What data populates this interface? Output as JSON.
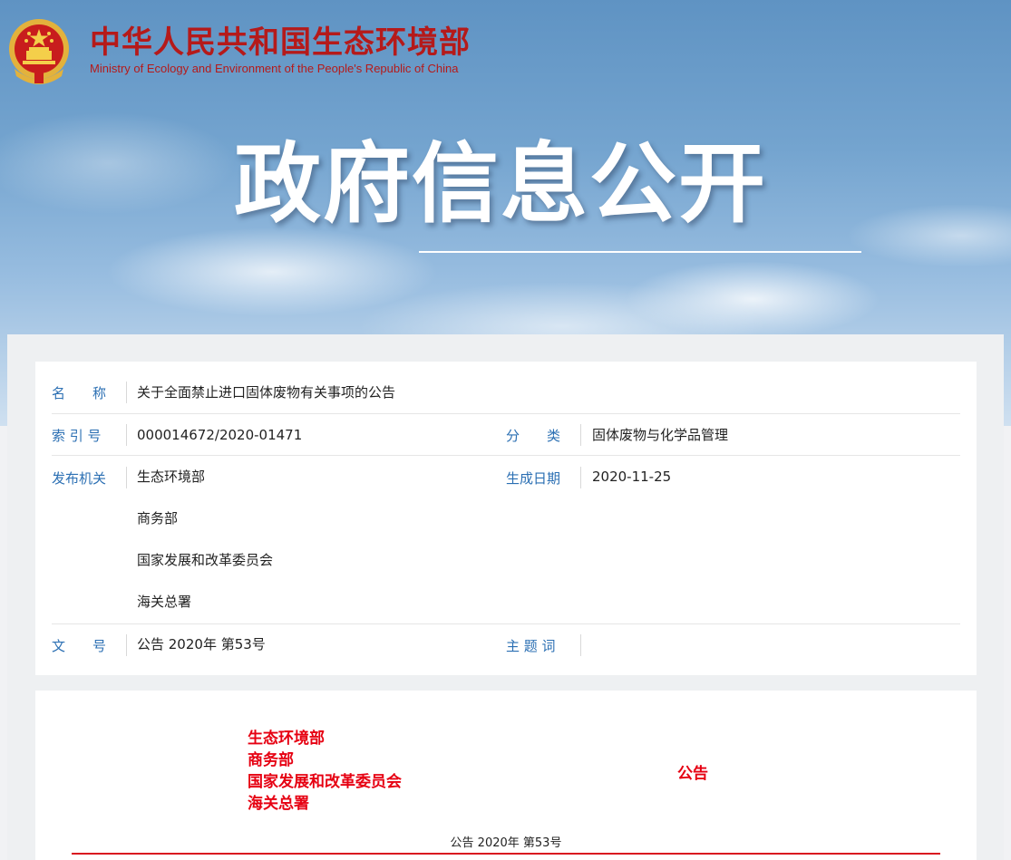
{
  "site": {
    "name_cn": "中华人民共和国生态环境部",
    "name_en": "Ministry of Ecology and Environment of the People's Republic of China",
    "emblem_icon": "national-emblem-icon"
  },
  "hero": {
    "title": "政府信息公开"
  },
  "info": {
    "name_label": "名　　称",
    "name_value": "关于全面禁止进口固体废物有关事项的公告",
    "index_label": "索 引 号",
    "index_value": "000014672/2020-01471",
    "category_label": "分　　类",
    "category_value": "固体废物与化学品管理",
    "issuer_label": "发布机关",
    "issuers": [
      "生态环境部",
      "商务部",
      "国家发展和改革委员会",
      "海关总署"
    ],
    "date_label": "生成日期",
    "date_value": "2020-11-25",
    "docno_label": "文　　号",
    "docno_value": "公告 2020年 第53号",
    "keywords_label": "主 题 词",
    "keywords_value": ""
  },
  "document": {
    "issuers": [
      "生态环境部",
      "商务部",
      "国家发展和改革委员会",
      "海关总署"
    ],
    "notice_word": "公告",
    "number": "公告 2020年 第53号"
  },
  "colors": {
    "brand_red": "#b51a1a",
    "label_blue": "#2b6fb3",
    "doc_red": "#e60012"
  }
}
